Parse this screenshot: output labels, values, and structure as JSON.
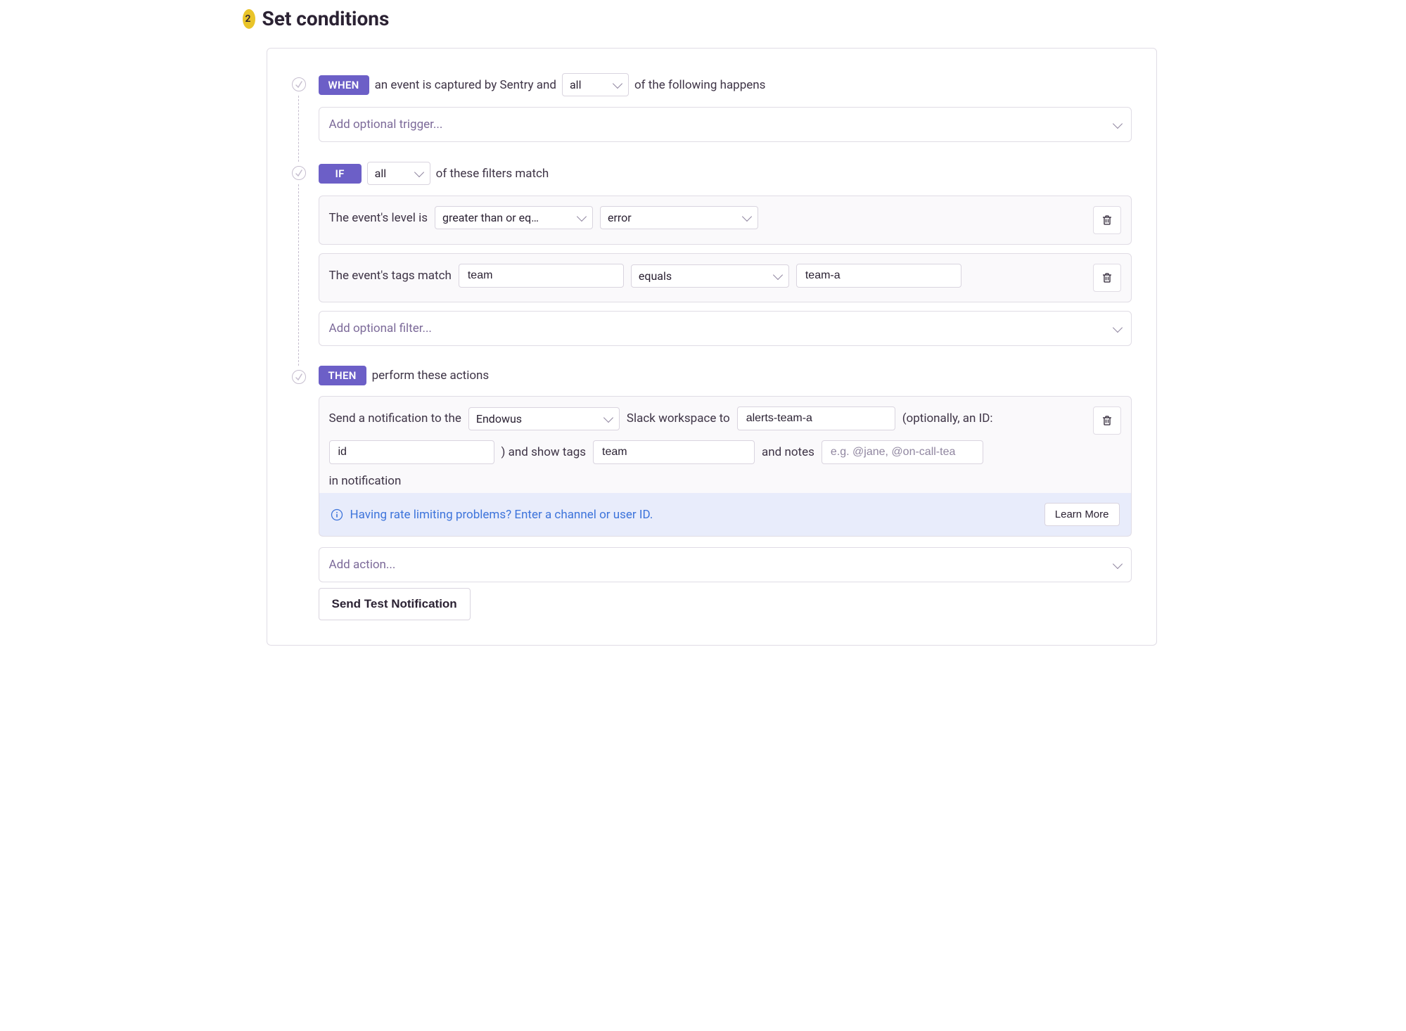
{
  "step_number": "2",
  "section_title": "Set conditions",
  "when": {
    "badge": "WHEN",
    "pre_text": "an event is captured by Sentry and",
    "match_select": "all",
    "post_text": "of the following happens",
    "add_placeholder": "Add optional trigger..."
  },
  "if": {
    "badge": "IF",
    "match_select": "all",
    "post_text": "of these filters match",
    "rows": [
      {
        "label": "The event's level is",
        "comparator": "greater than or eq…",
        "value": "error"
      },
      {
        "label": "The event's tags match",
        "tag_key": "team",
        "comparator": "equals",
        "tag_value": "team-a"
      }
    ],
    "add_placeholder": "Add optional filter..."
  },
  "then": {
    "badge": "THEN",
    "post_text": "perform these actions",
    "action": {
      "prefix1": "Send a notification to the",
      "workspace": "Endowus",
      "mid1": "Slack workspace to",
      "channel": "alerts-team-a",
      "mid2": "(optionally, an ID:",
      "id_value": "id",
      "mid3": ") and show tags",
      "tags_value": "team",
      "mid4": "and notes",
      "notes_placeholder": "e.g. @jane, @on-call-tea",
      "suffix": "in notification"
    },
    "info_text": "Having rate limiting problems? Enter a channel or user ID.",
    "learn_more": "Learn More",
    "add_placeholder": "Add action...",
    "test_button": "Send Test Notification"
  }
}
